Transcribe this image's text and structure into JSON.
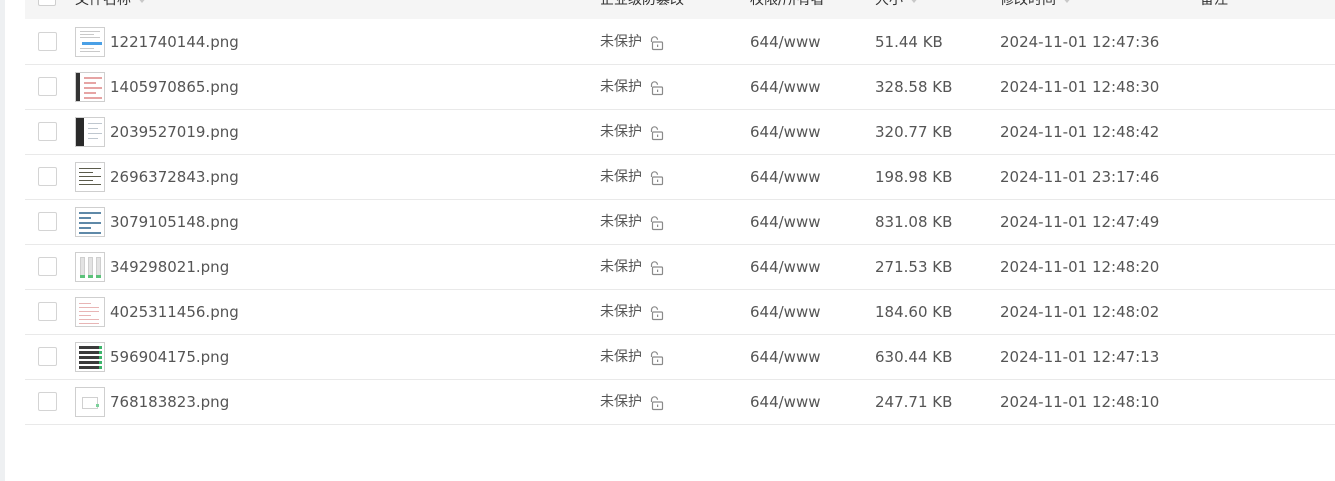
{
  "header": {
    "columns": [
      {
        "label": "文件名称",
        "sortable": true
      },
      {
        "label": "企业级防篡改",
        "sortable": false
      },
      {
        "label": "权限/所有者",
        "sortable": false
      },
      {
        "label": "大小",
        "sortable": true
      },
      {
        "label": "修改时间",
        "sortable": true
      },
      {
        "label": "备注",
        "sortable": false
      }
    ]
  },
  "files": [
    {
      "name": "1221740144.png",
      "protection": "未保护",
      "permission": "644/www",
      "size": "51.44 KB",
      "modified": "2024-11-01 12:47:36",
      "thumb": "light"
    },
    {
      "name": "1405970865.png",
      "protection": "未保护",
      "permission": "644/www",
      "size": "328.58 KB",
      "modified": "2024-11-01 12:48:30",
      "thumb": "pinkish"
    },
    {
      "name": "2039527019.png",
      "protection": "未保护",
      "permission": "644/www",
      "size": "320.77 KB",
      "modified": "2024-11-01 12:48:42",
      "thumb": "darkside"
    },
    {
      "name": "2696372843.png",
      "protection": "未保护",
      "permission": "644/www",
      "size": "198.98 KB",
      "modified": "2024-11-01 23:17:46",
      "thumb": "dark"
    },
    {
      "name": "3079105148.png",
      "protection": "未保护",
      "permission": "644/www",
      "size": "831.08 KB",
      "modified": "2024-11-01 12:47:49",
      "thumb": "blue"
    },
    {
      "name": "349298021.png",
      "protection": "未保护",
      "permission": "644/www",
      "size": "271.53 KB",
      "modified": "2024-11-01 12:48:20",
      "thumb": "grid"
    },
    {
      "name": "4025311456.png",
      "protection": "未保护",
      "permission": "644/www",
      "size": "184.60 KB",
      "modified": "2024-11-01 12:48:02",
      "thumb": "chart"
    },
    {
      "name": "596904175.png",
      "protection": "未保护",
      "permission": "644/www",
      "size": "630.44 KB",
      "modified": "2024-11-01 12:47:13",
      "thumb": "stripe"
    },
    {
      "name": "768183823.png",
      "protection": "未保护",
      "permission": "644/www",
      "size": "247.71 KB",
      "modified": "2024-11-01 12:48:10",
      "thumb": "whitebox"
    }
  ],
  "icons": {
    "protection": "unlock-icon",
    "sort": "sort-caret-icon"
  }
}
